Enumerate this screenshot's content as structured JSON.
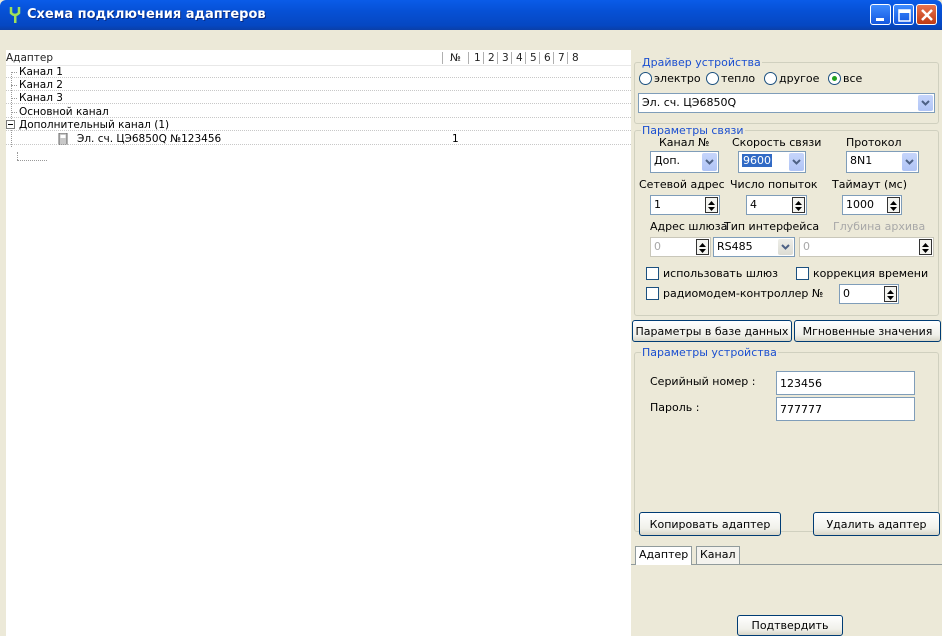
{
  "window": {
    "title": "Схема подключения адаптеров"
  },
  "tree": {
    "columns": {
      "adapter": "Адаптер",
      "number": "№",
      "slots": [
        "1",
        "2",
        "3",
        "4",
        "5",
        "6",
        "7",
        "8"
      ]
    },
    "rows": [
      {
        "label": "Канал 1",
        "number": ""
      },
      {
        "label": "Канал 2",
        "number": ""
      },
      {
        "label": "Канал 3",
        "number": ""
      },
      {
        "label": "Основной канал",
        "number": ""
      },
      {
        "label": "Дополнительный канал (1)",
        "number": ""
      },
      {
        "label": "Эл. сч. ЦЭ6850Q №123456",
        "number": "1"
      }
    ]
  },
  "driver": {
    "title": "Драйвер устройства",
    "radios": [
      "электро",
      "тепло",
      "другое",
      "все"
    ],
    "selected_radio": "все",
    "device_value": "Эл. сч. ЦЭ6850Q"
  },
  "comm": {
    "title": "Параметры связи",
    "channel_label": "Канал №",
    "channel_value": "Доп.",
    "speed_label": "Скорость связи",
    "speed_value": "9600",
    "protocol_label": "Протокол",
    "protocol_value": "8N1",
    "net_addr_label": "Сетевой адрес",
    "net_addr_value": "1",
    "attempts_label": "Число попыток",
    "attempts_value": "4",
    "timeout_label": "Таймаут (мс)",
    "timeout_value": "1000",
    "gateway_addr_label": "Адрес шлюза",
    "gateway_addr_value": "0",
    "iface_label": "Тип интерфейса",
    "iface_value": "RS485",
    "archive_depth_label": "Глубина архива",
    "archive_depth_value": "0",
    "use_gateway_label": "использовать шлюз",
    "time_correction_label": "коррекция времени",
    "radiomodem_label": "радиомодем-контроллер №",
    "radiomodem_value": "0"
  },
  "buttons": {
    "db_params": "Параметры в базе данных",
    "instant_values": "Мгновенные значения",
    "copy_adapter": "Копировать адаптер",
    "delete_adapter": "Удалить адаптер",
    "confirm": "Подтвердить"
  },
  "device": {
    "title": "Параметры устройства",
    "serial_label": "Серийный номер :",
    "serial_value": "123456",
    "password_label": "Пароль :",
    "password_value": "777777"
  },
  "tabs": [
    "Адаптер",
    "Канал"
  ],
  "colors": {
    "title_bar": "#0a5ce8",
    "group_title": "#1b4fd0",
    "selection": "#316ac5"
  }
}
